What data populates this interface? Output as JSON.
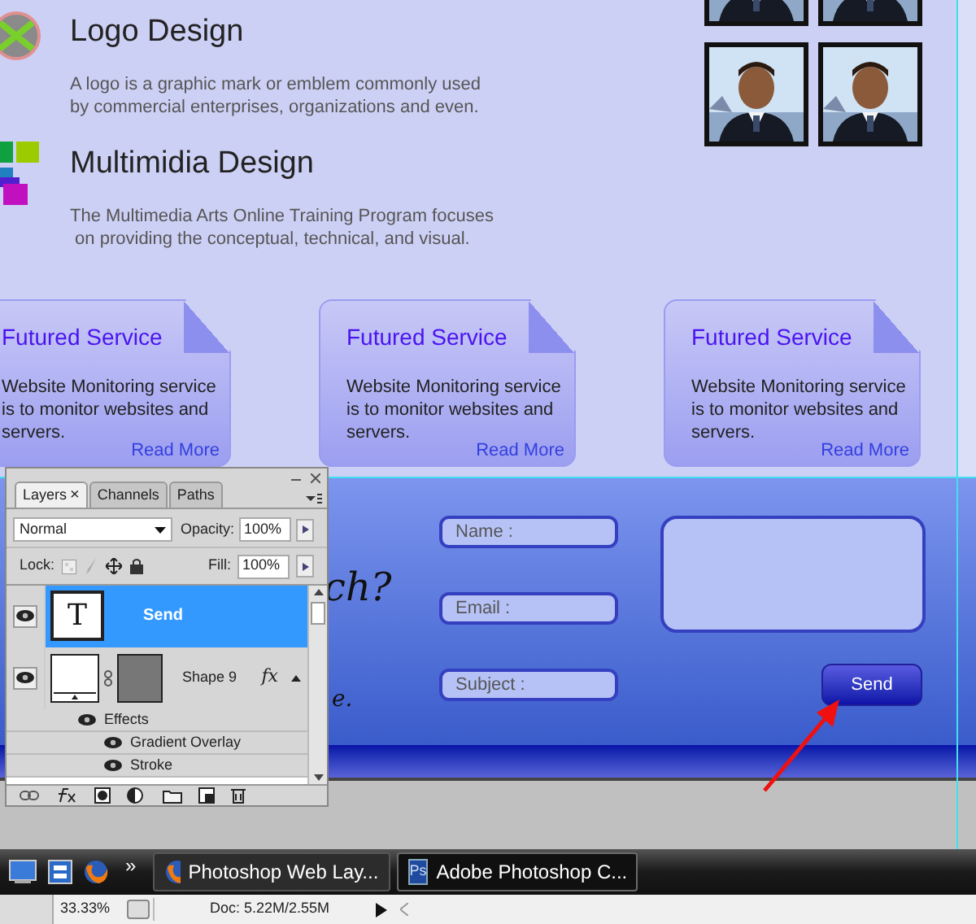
{
  "services": [
    {
      "kind": "round-logo",
      "title": "Logo Design",
      "description": "A logo is a graphic mark or emblem commonly used\nby commercial enterprises, organizations and even."
    },
    {
      "kind": "squares",
      "title": "Multimidia Design",
      "description": "The Multimedia Arts Online Training Program focuses\n on providing the conceptual, technical, and visual."
    }
  ],
  "feature_cards": [
    {
      "title": "Futured Service",
      "text": "Website Monitoring service\nis to monitor websites and\nservers.",
      "link": "Read More"
    },
    {
      "title": "Futured Service",
      "text": "Website Monitoring service\nis to monitor websites and\nservers.",
      "link": "Read More"
    },
    {
      "title": "Futured Service",
      "text": "Website Monitoring service\nis to monitor websites and\nservers.",
      "link": "Read More"
    }
  ],
  "contact": {
    "heading_fragments": [
      "ch?",
      "e."
    ],
    "fields": [
      {
        "placeholder": "Name :"
      },
      {
        "placeholder": "Email :"
      },
      {
        "placeholder": "Subject :"
      }
    ],
    "send_button": "Send"
  },
  "layers_panel": {
    "tabs": [
      {
        "label": "Layers",
        "selected": true,
        "close": "×"
      },
      {
        "label": "Channels",
        "selected": false
      },
      {
        "label": "Paths",
        "selected": false
      }
    ],
    "blend_mode": "Normal",
    "opacity_label": "Opacity:",
    "opacity": "100%",
    "lock_label": "Lock:",
    "fill_label": "Fill:",
    "fill": "100%",
    "layers": [
      {
        "kind": "text",
        "name": "Send",
        "thumb_text": "T",
        "visible": true,
        "selected": true
      },
      {
        "kind": "shape",
        "name": "Shape 9",
        "fx": "fx",
        "visible": true,
        "selected": false,
        "effects_label": "Effects",
        "children": [
          {
            "name": "Gradient Overlay",
            "visible": true
          },
          {
            "name": "Stroke",
            "visible": true
          }
        ]
      }
    ]
  },
  "taskbar": {
    "chevron": "»",
    "items": [
      {
        "kind": "firefox",
        "label": "Photoshop Web Lay...",
        "selected": false
      },
      {
        "kind": "photoshop",
        "icon_text": "Ps",
        "label": "Adobe Photoshop C...",
        "selected": true
      }
    ]
  },
  "status_bar": {
    "zoom": "33.33%",
    "doc": "Doc: 5.22M/2.55M"
  }
}
